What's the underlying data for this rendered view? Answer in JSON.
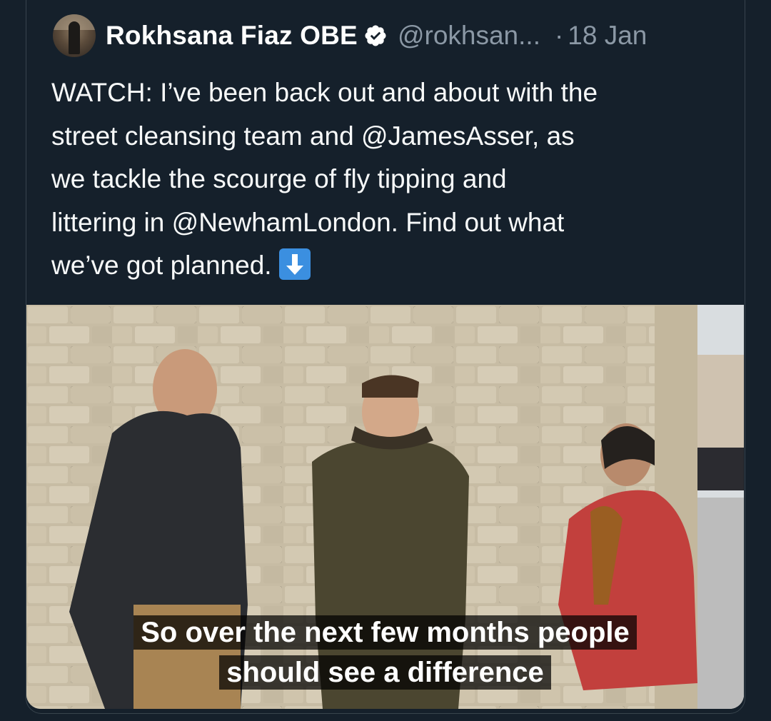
{
  "tweet": {
    "author_name": "Rokhsana Fiaz OBE",
    "handle": "@rokhsan...",
    "separator": "·",
    "date": "18 Jan",
    "text_lines": [
      "WATCH: I’ve been back out and about with the",
      "street cleansing team and @JamesAsser, as",
      "we tackle the scourge of fly tipping and",
      "littering in @NewhamLondon. Find out what",
      "we’ve got planned."
    ],
    "emoji": "down-arrow-emoji"
  },
  "video": {
    "caption_line_1": "So over the next few months people",
    "caption_line_2": "should see a difference"
  },
  "colors": {
    "background": "#15202b",
    "text": "#f7f9f9",
    "secondary": "#8b98a5",
    "verified_badge": "#ffffff",
    "emoji_blue": "#3b8fe0"
  },
  "icons": {
    "verified": "verified-badge-icon",
    "arrow": "down-arrow-icon"
  }
}
